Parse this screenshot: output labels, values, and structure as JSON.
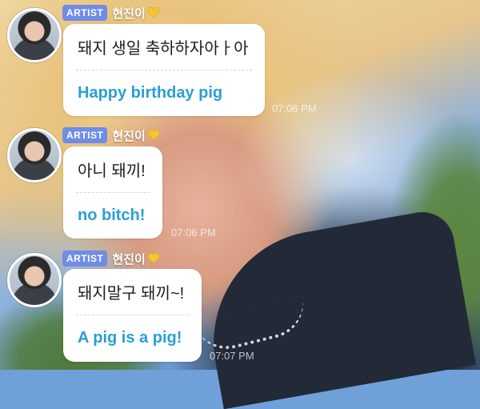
{
  "messages": [
    {
      "badge": "ARTIST",
      "name": "현진이",
      "original": "돼지 생일 축하하자아ㅏ아",
      "translation": "Happy birthday pig",
      "time": "07:06 PM"
    },
    {
      "badge": "ARTIST",
      "name": "현진이",
      "original": "아니 돼끼!",
      "translation": "no bitch!",
      "time": "07:06 PM"
    },
    {
      "badge": "ARTIST",
      "name": "현진이",
      "original": "돼지말구 돼끼~!",
      "translation": "A pig is a pig!",
      "time": "07:07 PM"
    }
  ],
  "icons": {
    "heart": "yellow-heart-icon",
    "avatar": "avatar"
  },
  "colors": {
    "badge": "#6f8ce8",
    "translation_text": "#2a9fd6",
    "heart": "#f7c531"
  }
}
